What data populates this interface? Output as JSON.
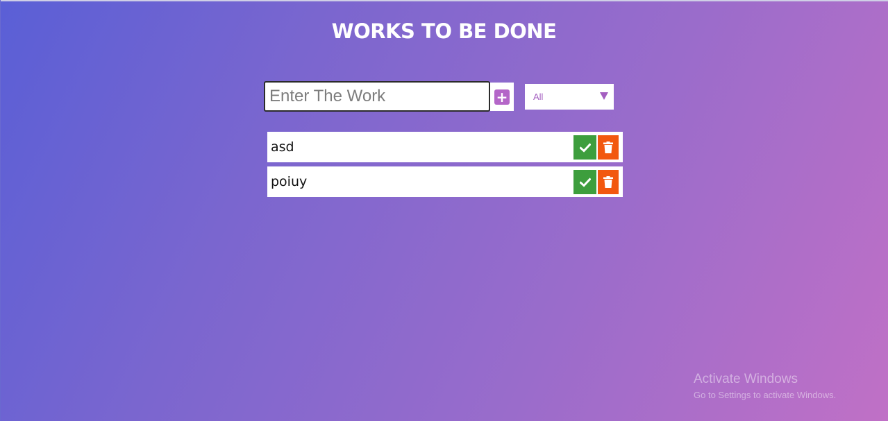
{
  "app": {
    "title": "WORKS TO BE DONE"
  },
  "input": {
    "placeholder": "Enter The Work",
    "value": ""
  },
  "add_button": {
    "icon": "plus-square-icon",
    "label": "+"
  },
  "filter": {
    "selected": "All"
  },
  "todos": [
    {
      "text": "asd"
    },
    {
      "text": "poiuy"
    }
  ],
  "colors": {
    "accent": "#b466c8",
    "complete": "#3d9e3d",
    "delete": "#f2580f",
    "gradient_start": "#5a5fd6",
    "gradient_end": "#c070c6"
  },
  "watermark": {
    "title": "Activate Windows",
    "subtitle": "Go to Settings to activate Windows."
  }
}
